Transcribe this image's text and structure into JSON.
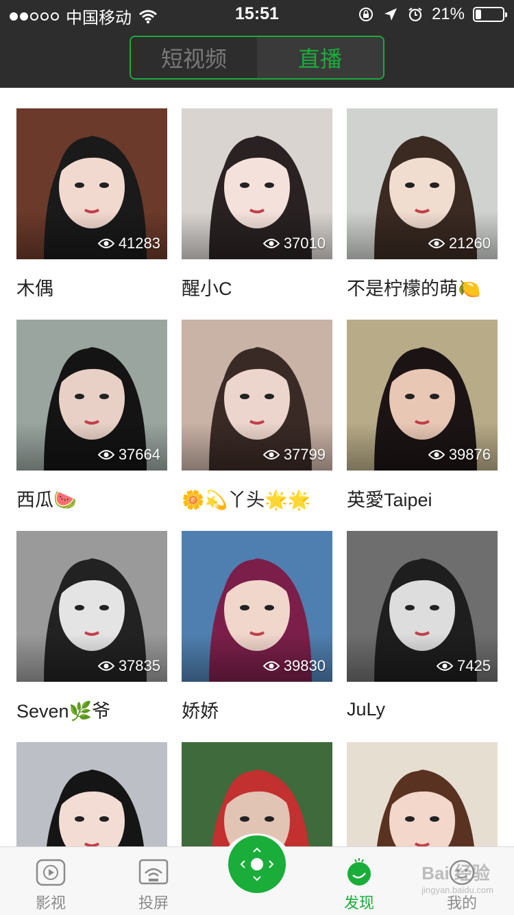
{
  "status_bar": {
    "carrier": "中国移动",
    "time": "15:51",
    "battery": "21%",
    "battery_level": 0.21,
    "signal_bars": 2,
    "icons": [
      "wifi-icon",
      "lock-rotation-icon",
      "location-arrow-icon",
      "alarm-icon",
      "battery-icon"
    ]
  },
  "segment": {
    "short_video_label": "短视频",
    "live_label": "直播",
    "active": "live"
  },
  "colors": {
    "accent": "#1aad3a",
    "header_bg": "#2d2d2d",
    "tabbar_bg": "#f7f7f7"
  },
  "streams": [
    {
      "name": "木偶",
      "views": "41283"
    },
    {
      "name": "醒小C",
      "views": "37010"
    },
    {
      "name": "不是柠檬的萌🍋",
      "views": "21260"
    },
    {
      "name": "西瓜🍉",
      "views": "37664"
    },
    {
      "name": "🌼💫丫头🌟🌟",
      "views": "37799"
    },
    {
      "name": "英愛Taipei",
      "views": "39876"
    },
    {
      "name": "Seven🌿爷",
      "views": "37835"
    },
    {
      "name": "娇娇",
      "views": "39830"
    },
    {
      "name": "JuLy",
      "views": "7425"
    },
    {
      "name": "",
      "views": ""
    },
    {
      "name": "",
      "views": ""
    },
    {
      "name": "",
      "views": ""
    }
  ],
  "tabs": [
    {
      "label": "影视",
      "icon": "video-icon"
    },
    {
      "label": "投屏",
      "icon": "cast-screen-icon"
    },
    {
      "label": "发现",
      "icon": "discover-icon",
      "active": true
    },
    {
      "label": "我的",
      "icon": "profile-icon"
    }
  ],
  "watermark": {
    "text": "Bai 经验",
    "sub": "jingyan.baidu.com"
  }
}
